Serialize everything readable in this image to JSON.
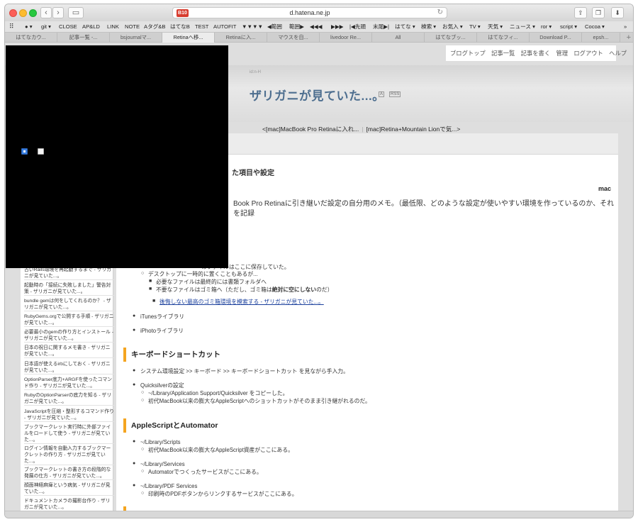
{
  "browser": {
    "url": "d.hatena.ne.jp",
    "badge": "10",
    "bookmarks": [
      "git ▾",
      "CLOSE",
      "AP&LD",
      "LINK",
      "NOTE",
      "Aタグ&B",
      "はてなB",
      "TEST",
      "AUTOFIT",
      "▼▼▼▼",
      "◀範囲",
      "範囲▶",
      "◀◀◀",
      "▶▶▶",
      "|◀先頭",
      "末尾▶|",
      "はてな ▾",
      "検索 ▾",
      "お気入 ▾",
      "TV ▾",
      "天気 ▾",
      "ニュース ▾",
      "ror ▾",
      "script ▾",
      "Cocoa ▾"
    ],
    "tabs": [
      "はてなカウ...",
      "記事一覧 -...",
      "bsjournalマ...",
      "Retinaへ移...",
      "Retinaに入...",
      "マウスを自...",
      "livedoor Re...",
      "All",
      "はてなブッ...",
      "はてなフィ...",
      "Download P...",
      "epsh..."
    ],
    "active_tab": 3
  },
  "hatena": {
    "links": [
      "ブログトップ",
      "記事一覧",
      "記事を書く",
      "管理",
      "ログアウト",
      "ヘルプ"
    ],
    "subtitle_mark": "id:n-H",
    "blog_title": "ザリガニが見ていた...。",
    "feed_labels": [
      "A",
      "RSS"
    ],
    "prev_entry": "<[mac]MacBook Pro Retinaに入れ...",
    "next_entry": "[mac]Retina+Mountain Lionで気...>"
  },
  "article": {
    "section_title_fragment": "た項目や設定",
    "tag": "mac",
    "intro": "Book Pro Retinaに引き継いだ設定の自分用のメモ。（最低限、どのような設定が使いやすい環境を作っているのか、それを記録",
    "lines": {
      "l1": "のファイルはここに保存していた。",
      "l2": "デスクトップに一時的に置くこともあるが...",
      "l3": "必要なファイルは最終的には書類フォルダへ",
      "l4_prefix": "不要なファイルはゴミ箱へ（ただし、ゴミ箱は",
      "l4_bold": "絶対に空にしない",
      "l4_suffix": "のだ）",
      "link": "後悔しない最高のゴミ箱環境を模索する - ザリガニが見ていた...。",
      "itunes": "iTunesライブラリ",
      "iphoto": "iPhotoライブラリ"
    },
    "h_keyboard": "キーボードショートカット",
    "kb1": "システム環境設定 >> キーボード >> キーボードショートカット を見ながら手入力。",
    "qs": "Quicksilverの設定",
    "qs1": "~/Library/Application Support/Quicksilver をコピーした。",
    "qs2": "初代MacBook以来の膨大なAppleScriptへのショットカットがそのまま引き継がれるのだ。",
    "h_applescript": "AppleScriptとAutomator",
    "as1": "~/Library/Scripts",
    "as1a": "初代MacBook以来の膨大なAppleScript資産がここにある。",
    "as2": "~/Library/Services",
    "as2a": "Automatorでつくったサービスがここにある。",
    "as3": "~/Library/PDF Services",
    "as3a": "印刷時のPDFボタンからリンクするサービスがここにある。"
  },
  "sidebar": {
    "items": [
      "古いRails環境を再起動するまで - ザリガニが見ていた...。",
      "起動時の「接続に失敗しました」警告対策 - ザリガニが見ていた...。",
      "bundle gemは何をしてくれるのか？ - ザリガニが見ていた...。",
      "RubyGems.orgで公開する手順 - ザリガニが見ていた...。",
      "必要最小のgemの作り方とインストール - ザリガニが見ていた...。",
      "日本の祝日に関するメモ書き - ザリガニが見ていた...。",
      "日本語が使えるirbにしておく - ザリガニが見ていた...。",
      "OptionParser底力+ARGFを使ったコマンド作り - ザリガニが見ていた...。",
      "RubyのOptionParserの底力を知る - ザリガニが見ていた...。",
      "JavaScriptを圧縮・整形するコマンド作り - ザリガニが見ていた...。",
      "ブックマークレット実行時に外部ファイルをロードして使う - ザリガニが見ていた...。",
      "ログイン情報を自動入力するブックマークレットの作り方 - ザリガニが見ていた...。",
      "ブックマークレットの書き方の段階的な発展の仕方 - ザリガニが見ていた...。",
      "顔面神経麻痺という病気 - ザリガニが見ていた...。",
      "ドキュメントカメラの撮影台作り - ザリガニが見ていた...。"
    ]
  }
}
